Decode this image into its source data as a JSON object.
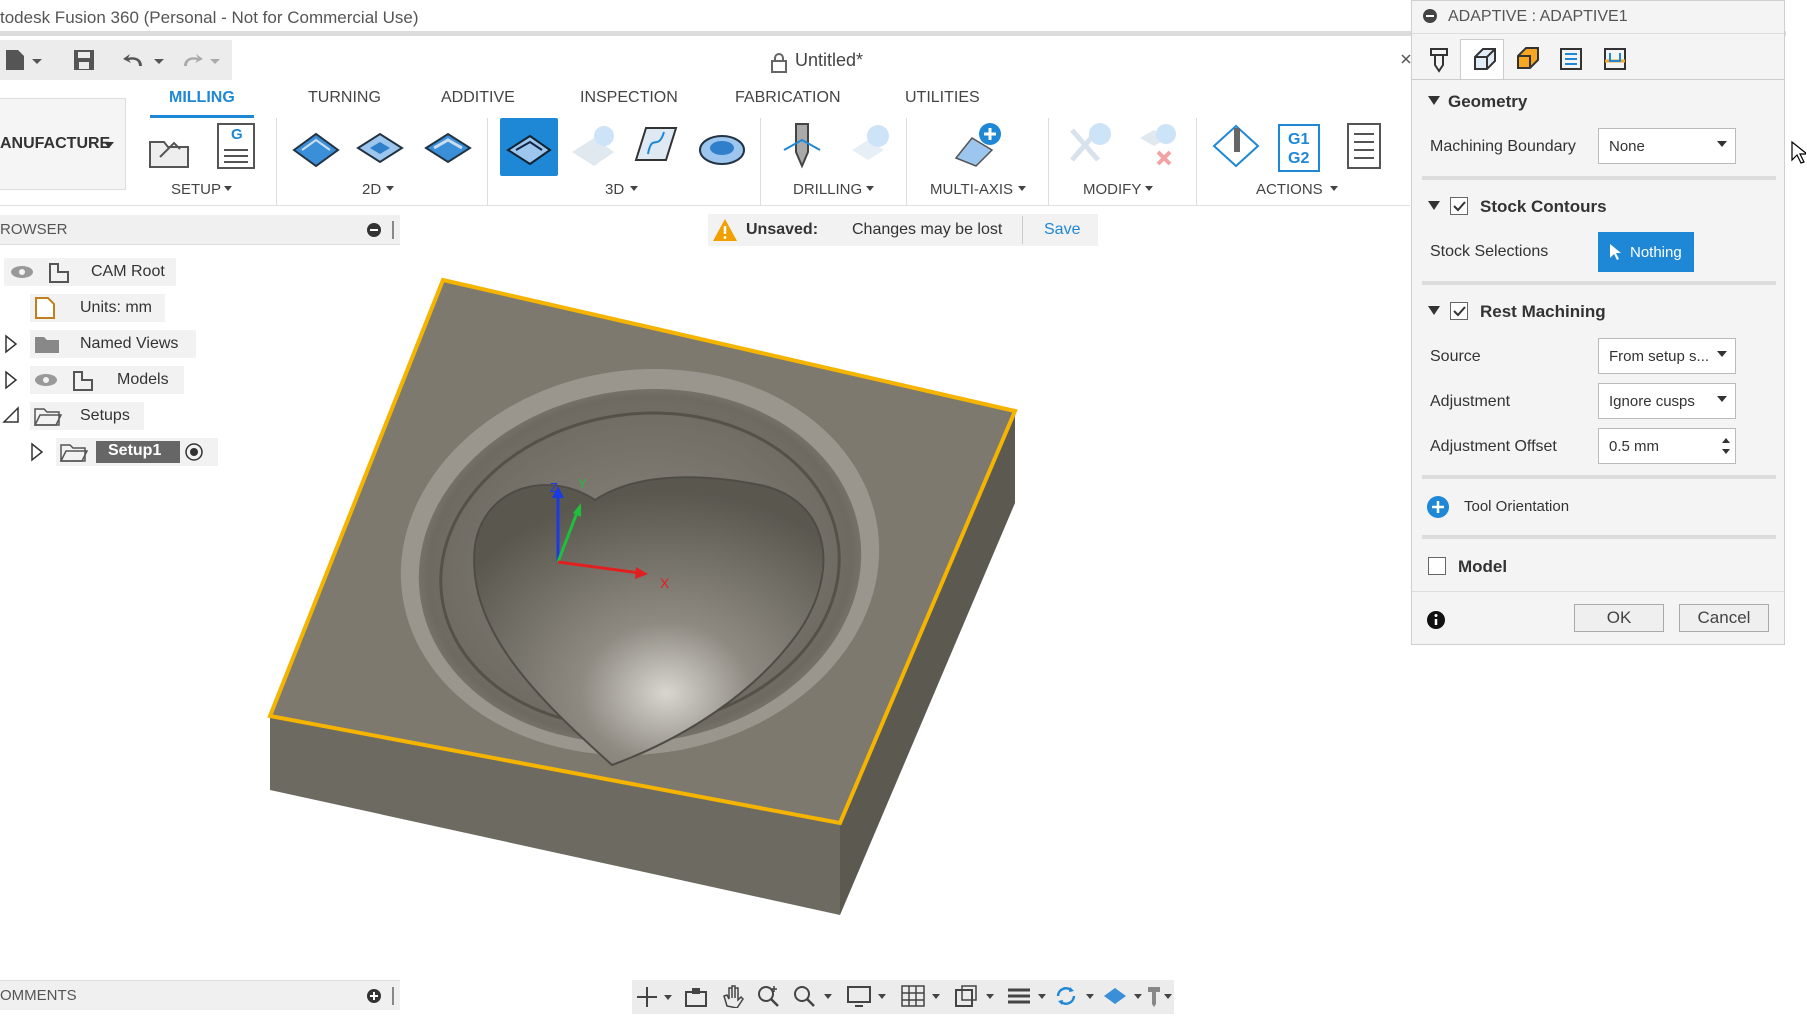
{
  "app": {
    "window_title": "todesk Fusion 360 (Personal - Not for Commercial Use)",
    "document_title": "Untitled*"
  },
  "ribbon": {
    "workspace": "ANUFACTURE",
    "tabs": [
      "MILLING",
      "TURNING",
      "ADDITIVE",
      "INSPECTION",
      "FABRICATION",
      "UTILITIES"
    ],
    "groups": [
      "SETUP",
      "2D",
      "3D",
      "DRILLING",
      "MULTI-AXIS",
      "MODIFY",
      "ACTIONS"
    ],
    "nc_label": "G",
    "g1g2": [
      "G1",
      "G2"
    ]
  },
  "browser": {
    "header": "ROWSER",
    "items": [
      "CAM Root",
      "Units: mm",
      "Named Views",
      "Models",
      "Setups",
      "Setup1"
    ]
  },
  "notice": {
    "title": "Unsaved:",
    "message": "Changes may be lost",
    "save": "Save"
  },
  "axes": {
    "x": "X",
    "y": "Y",
    "z": "Z"
  },
  "comments": {
    "header": "OMMENTS"
  },
  "dialog": {
    "title": "ADAPTIVE : ADAPTIVE1",
    "geometry": {
      "label": "Geometry",
      "boundary_label": "Machining Boundary",
      "boundary_value": "None"
    },
    "stock_contours": {
      "label": "Stock Contours",
      "checked": true,
      "selections_label": "Stock Selections",
      "selections_value": "Nothing"
    },
    "rest_machining": {
      "label": "Rest Machining",
      "checked": true,
      "source_label": "Source",
      "source_value": "From setup s...",
      "adjustment_label": "Adjustment",
      "adjustment_value": "Ignore cusps",
      "offset_label": "Adjustment Offset",
      "offset_value": "0.5 mm"
    },
    "tool_orientation": "Tool Orientation",
    "model": {
      "label": "Model",
      "checked": false
    },
    "ok": "OK",
    "cancel": "Cancel"
  },
  "colors": {
    "accent": "#1e88d6",
    "selection_edge": "#f5b400",
    "warning": "#f0a000",
    "body": "#6e6a62"
  }
}
